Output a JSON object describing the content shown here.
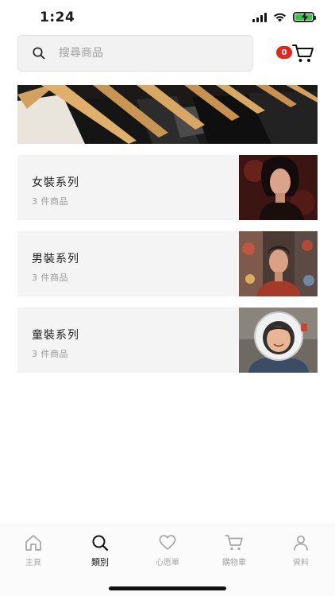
{
  "status_bar": {
    "time": "1:24",
    "icons": [
      "signal-icon",
      "wifi-icon",
      "battery-charging-icon"
    ],
    "battery_color": "#33c748"
  },
  "search": {
    "placeholder": "搜尋商品",
    "value": ""
  },
  "cart": {
    "badge_count": "0",
    "badge_color": "#e0271e"
  },
  "categories": [
    {
      "title": "女裝系列",
      "count": "3 件商品"
    },
    {
      "title": "男裝系列",
      "count": "3 件商品"
    },
    {
      "title": "童裝系列",
      "count": "3 件商品"
    }
  ],
  "tab_bar": {
    "items": [
      {
        "label": "主頁",
        "icon": "home-icon",
        "active": false
      },
      {
        "label": "類別",
        "icon": "search-icon",
        "active": true
      },
      {
        "label": "心愿單",
        "icon": "heart-icon",
        "active": false
      },
      {
        "label": "購物車",
        "icon": "cart-icon",
        "active": false
      },
      {
        "label": "資料",
        "icon": "person-icon",
        "active": false
      }
    ]
  }
}
